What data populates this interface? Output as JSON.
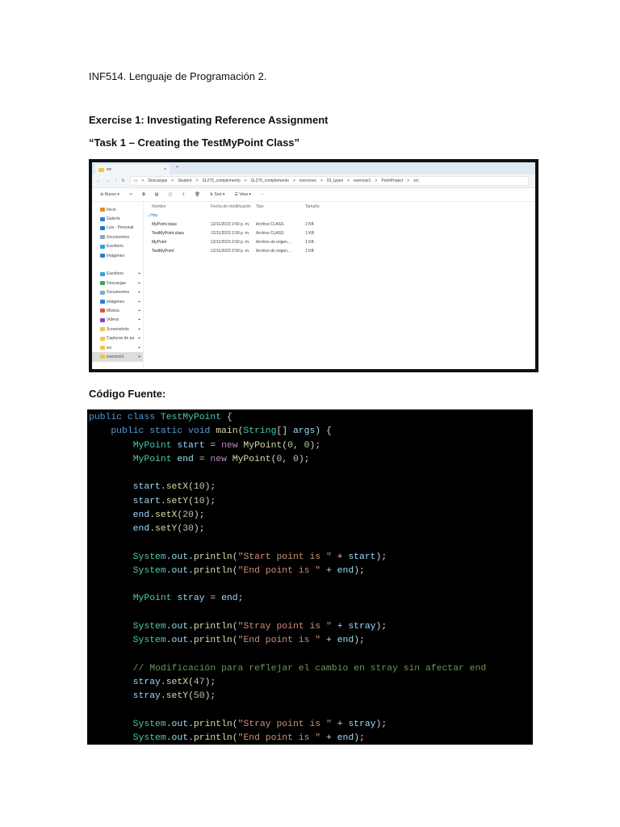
{
  "header": "INF514. Lenguaje de Programación 2.",
  "exercise_title": "Exercise 1: Investigating Reference Assignment",
  "task_title": "“Task 1 – Creating the TestMyPoint Class”",
  "source_label": "Código Fuente:",
  "explorer": {
    "tab": "src",
    "tab_close": "×",
    "tab_add": "+",
    "breadcrumbs": [
      "Descargas",
      "Student",
      "SL275_complemento",
      "SL275_complemento",
      "exercises",
      "03_types",
      "exercise1",
      "PointProject",
      "src"
    ],
    "toolbar": {
      "new": "Nuevo",
      "sort": "Sort",
      "view": "View",
      "more": "···"
    },
    "nav": [
      {
        "label": "Inicio",
        "color": "#e58a2c"
      },
      {
        "label": "Galería",
        "color": "#2b7fd6"
      },
      {
        "label": "Luis - Personal",
        "color": "#1e78d4"
      },
      {
        "label": "Documentos",
        "color": "#8aa4c8"
      },
      {
        "label": "Escritorio",
        "color": "#2ea3e0"
      },
      {
        "label": "Imágenes",
        "color": "#2b7fd6"
      },
      {
        "label": ""
      },
      {
        "label": "Escritorio",
        "color": "#2ea3e0"
      },
      {
        "label": "Descargas",
        "color": "#2fa865"
      },
      {
        "label": "Documentos",
        "color": "#8aa4c8"
      },
      {
        "label": "Imágenes",
        "color": "#2b7fd6"
      },
      {
        "label": "Música",
        "color": "#e5533c"
      },
      {
        "label": "Videos",
        "color": "#8a3fd1"
      },
      {
        "label": "Screenshots",
        "color": "#f4c542"
      },
      {
        "label": "Capturas de pa",
        "color": "#f4c542"
      },
      {
        "label": "src",
        "color": "#f4c542"
      },
      {
        "label": "exercise1",
        "color": "#f4c542"
      }
    ],
    "columns": [
      "Nombre",
      "Fecha de modificación",
      "Tipo",
      "Tamaño"
    ],
    "group": "Hoy",
    "files": [
      {
        "name": "MyPoint.class",
        "date": "12/11/2023 2:50 p. m.",
        "type": "Archivo CLASS",
        "size": "1 KB"
      },
      {
        "name": "TestMyPoint.class",
        "date": "12/11/2023 2:50 p. m.",
        "type": "Archivo CLASS",
        "size": "1 KB"
      },
      {
        "name": "MyPoint",
        "date": "12/11/2023 2:50 p. m.",
        "type": "Archivo de origen...",
        "size": "1 KB"
      },
      {
        "name": "TestMyPoint",
        "date": "12/11/2023 2:50 p. m.",
        "type": "Archivo de origen...",
        "size": "1 KB"
      }
    ]
  },
  "code_colors": {
    "k": "#569cd6",
    "t": "#4ec9b0",
    "v": "#9cdcfe",
    "m": "#dcdcaa",
    "n": "#c586c0",
    "d": "#b5cea8",
    "s": "#ce9178",
    "c": "#6a9955",
    "p": "#d4d4d4"
  },
  "code": [
    [
      [
        "public class ",
        "k"
      ],
      [
        "TestMyPoint",
        "t"
      ],
      [
        " {",
        "p"
      ]
    ],
    [
      [
        "    public static void ",
        "k"
      ],
      [
        "main",
        "m"
      ],
      [
        "(",
        "p"
      ],
      [
        "String",
        "t"
      ],
      [
        "[] ",
        "p"
      ],
      [
        "args",
        "v"
      ],
      [
        ") {",
        "p"
      ]
    ],
    [
      [
        "        ",
        "p"
      ],
      [
        "MyPoint",
        "t"
      ],
      [
        " start",
        "v"
      ],
      [
        " = ",
        "p"
      ],
      [
        "new ",
        "n"
      ],
      [
        "MyPoint",
        "m"
      ],
      [
        "(",
        "p"
      ],
      [
        "0",
        "d"
      ],
      [
        ", ",
        "p"
      ],
      [
        "0",
        "d"
      ],
      [
        ");",
        "p"
      ]
    ],
    [
      [
        "        ",
        "p"
      ],
      [
        "MyPoint",
        "t"
      ],
      [
        " end",
        "v"
      ],
      [
        " = ",
        "p"
      ],
      [
        "new ",
        "n"
      ],
      [
        "MyPoint",
        "m"
      ],
      [
        "(",
        "p"
      ],
      [
        "0",
        "d"
      ],
      [
        ", ",
        "p"
      ],
      [
        "0",
        "d"
      ],
      [
        ");",
        "p"
      ]
    ],
    [],
    [
      [
        "        start",
        "v"
      ],
      [
        ".",
        "p"
      ],
      [
        "setX",
        "m"
      ],
      [
        "(",
        "p"
      ],
      [
        "10",
        "d"
      ],
      [
        ");",
        "p"
      ]
    ],
    [
      [
        "        start",
        "v"
      ],
      [
        ".",
        "p"
      ],
      [
        "setY",
        "m"
      ],
      [
        "(",
        "p"
      ],
      [
        "10",
        "d"
      ],
      [
        ");",
        "p"
      ]
    ],
    [
      [
        "        end",
        "v"
      ],
      [
        ".",
        "p"
      ],
      [
        "setX",
        "m"
      ],
      [
        "(",
        "p"
      ],
      [
        "20",
        "d"
      ],
      [
        ");",
        "p"
      ]
    ],
    [
      [
        "        end",
        "v"
      ],
      [
        ".",
        "p"
      ],
      [
        "setY",
        "m"
      ],
      [
        "(",
        "p"
      ],
      [
        "30",
        "d"
      ],
      [
        ");",
        "p"
      ]
    ],
    [],
    [
      [
        "        System",
        "t"
      ],
      [
        ".",
        "p"
      ],
      [
        "out",
        "v"
      ],
      [
        ".",
        "p"
      ],
      [
        "println",
        "m"
      ],
      [
        "(",
        "p"
      ],
      [
        "\"Start point is \"",
        "s"
      ],
      [
        " + ",
        "p"
      ],
      [
        "start",
        "v"
      ],
      [
        ");",
        "p"
      ]
    ],
    [
      [
        "        System",
        "t"
      ],
      [
        ".",
        "p"
      ],
      [
        "out",
        "v"
      ],
      [
        ".",
        "p"
      ],
      [
        "println",
        "m"
      ],
      [
        "(",
        "p"
      ],
      [
        "\"End point is \"",
        "s"
      ],
      [
        " + ",
        "p"
      ],
      [
        "end",
        "v"
      ],
      [
        ");",
        "p"
      ]
    ],
    [],
    [
      [
        "        ",
        "p"
      ],
      [
        "MyPoint",
        "t"
      ],
      [
        " stray",
        "v"
      ],
      [
        " = ",
        "p"
      ],
      [
        "end",
        "v"
      ],
      [
        ";",
        "p"
      ]
    ],
    [],
    [
      [
        "        System",
        "t"
      ],
      [
        ".",
        "p"
      ],
      [
        "out",
        "v"
      ],
      [
        ".",
        "p"
      ],
      [
        "println",
        "m"
      ],
      [
        "(",
        "p"
      ],
      [
        "\"Stray point is \"",
        "s"
      ],
      [
        " + ",
        "p"
      ],
      [
        "stray",
        "v"
      ],
      [
        ");",
        "p"
      ]
    ],
    [
      [
        "        System",
        "t"
      ],
      [
        ".",
        "p"
      ],
      [
        "out",
        "v"
      ],
      [
        ".",
        "p"
      ],
      [
        "println",
        "m"
      ],
      [
        "(",
        "p"
      ],
      [
        "\"End point is \"",
        "s"
      ],
      [
        " + ",
        "p"
      ],
      [
        "end",
        "v"
      ],
      [
        ");",
        "p"
      ]
    ],
    [],
    [
      [
        "        // Modificación para reflejar el cambio en stray sin afectar end",
        "c"
      ]
    ],
    [
      [
        "        stray",
        "v"
      ],
      [
        ".",
        "p"
      ],
      [
        "setX",
        "m"
      ],
      [
        "(",
        "p"
      ],
      [
        "47",
        "d"
      ],
      [
        ");",
        "p"
      ]
    ],
    [
      [
        "        stray",
        "v"
      ],
      [
        ".",
        "p"
      ],
      [
        "setY",
        "m"
      ],
      [
        "(",
        "p"
      ],
      [
        "50",
        "d"
      ],
      [
        ");",
        "p"
      ]
    ],
    [],
    [
      [
        "        System",
        "t"
      ],
      [
        ".",
        "p"
      ],
      [
        "out",
        "v"
      ],
      [
        ".",
        "p"
      ],
      [
        "println",
        "m"
      ],
      [
        "(",
        "p"
      ],
      [
        "\"Stray point is \"",
        "s"
      ],
      [
        " + ",
        "p"
      ],
      [
        "stray",
        "v"
      ],
      [
        ");",
        "p"
      ]
    ],
    [
      [
        "        System",
        "t"
      ],
      [
        ".",
        "p"
      ],
      [
        "out",
        "v"
      ],
      [
        ".",
        "p"
      ],
      [
        "println",
        "m"
      ],
      [
        "(",
        "p"
      ],
      [
        "\"End point is \"",
        "s"
      ],
      [
        " + ",
        "p"
      ],
      [
        "end",
        "v"
      ],
      [
        ");",
        "p"
      ]
    ]
  ]
}
